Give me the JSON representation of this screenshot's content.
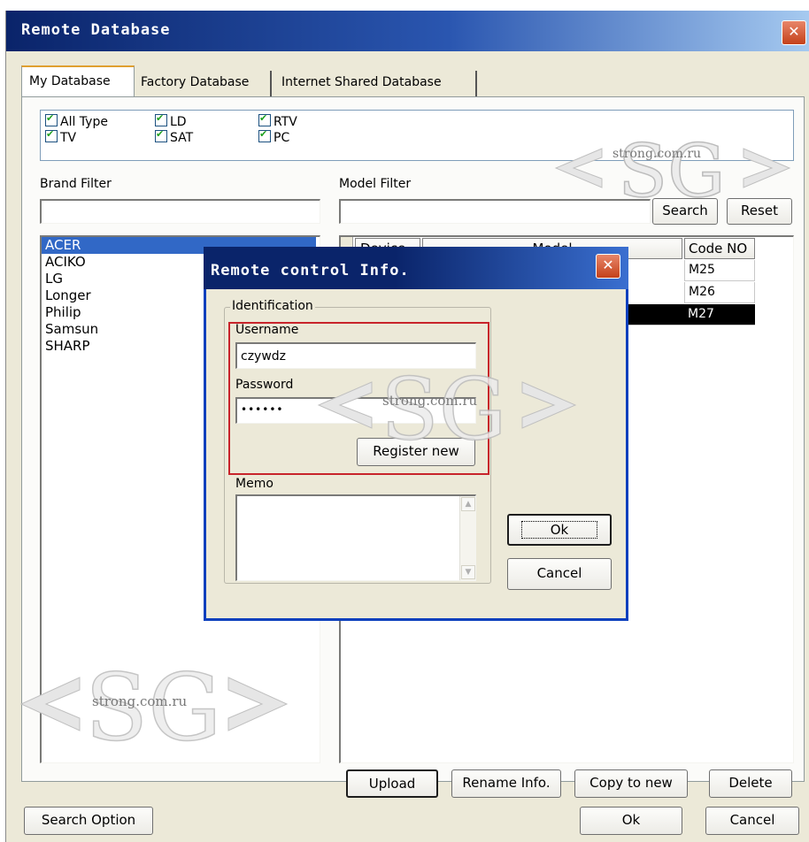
{
  "main_window": {
    "title": "Remote Database",
    "close_glyph": "✕",
    "tabs": [
      {
        "label": "My Database",
        "active": true
      },
      {
        "label": "Factory Database",
        "active": false
      },
      {
        "label": "Internet Shared Database",
        "active": false
      }
    ],
    "type_filters": [
      {
        "label": "All Type",
        "checked": true
      },
      {
        "label": "TV",
        "checked": true
      },
      {
        "label": "LD",
        "checked": true
      },
      {
        "label": "SAT",
        "checked": true
      },
      {
        "label": "RTV",
        "checked": true
      },
      {
        "label": "PC",
        "checked": true
      }
    ],
    "brand_filter_label": "Brand Filter",
    "brand_filter_value": "",
    "model_filter_label": "Model Filter",
    "model_filter_value": "",
    "search_button": "Search",
    "reset_button": "Reset",
    "brands": [
      "ACER",
      "ACIKO",
      "LG",
      "Longer",
      "Philip",
      "Samsun",
      "SHARP"
    ],
    "selected_brand": "ACER",
    "grid_headers": {
      "device": "Device",
      "model": "Model",
      "code": "Code NO"
    },
    "grid_rows": [
      {
        "code": "M25",
        "selected": false
      },
      {
        "code": "M26",
        "selected": false
      },
      {
        "code": "M27",
        "selected": true
      }
    ],
    "upload_button": "Upload",
    "rename_button": "Rename Info.",
    "copy_button": "Copy to new",
    "delete_button": "Delete",
    "search_option_button": "Search Option",
    "ok_button": "Ok",
    "cancel_button": "Cancel"
  },
  "dialog": {
    "title": "Remote control Info.",
    "close_glyph": "✕",
    "identification_label": "Identification",
    "username_label": "Username",
    "username_value": "czywdz",
    "password_label": "Password",
    "password_value": "••••••",
    "register_button": "Register new",
    "memo_label": "Memo",
    "memo_value": "",
    "ok_button": "Ok",
    "cancel_button": "Cancel"
  },
  "watermark": {
    "text": "strong.com.ru",
    "logo": "<SG>"
  },
  "colors": {
    "titlebar": "#0a246a",
    "selection": "#3168c6",
    "dialog_border": "#0b3fbd",
    "highlight_red": "#c8242b"
  }
}
